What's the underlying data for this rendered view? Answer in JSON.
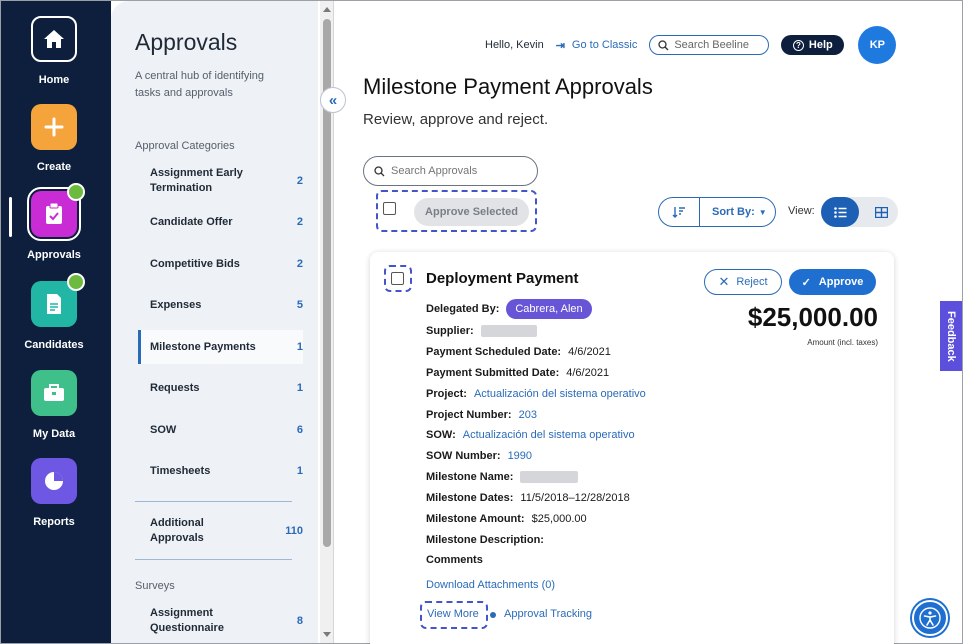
{
  "nav": {
    "items": [
      {
        "label": "Home",
        "icon": "home-icon"
      },
      {
        "label": "Create",
        "icon": "plus-icon"
      },
      {
        "label": "Approvals",
        "icon": "clipboard-check-icon"
      },
      {
        "label": "Candidates",
        "icon": "document-icon"
      },
      {
        "label": "My Data",
        "icon": "briefcase-icon"
      },
      {
        "label": "Reports",
        "icon": "pie-chart-icon"
      }
    ]
  },
  "panel": {
    "title": "Approvals",
    "subtitle": "A central hub of identifying tasks and approvals",
    "categories_header": "Approval Categories",
    "categories": [
      {
        "label": "Assignment Early Termination",
        "count": "2"
      },
      {
        "label": "Candidate Offer",
        "count": "2"
      },
      {
        "label": "Competitive Bids",
        "count": "2"
      },
      {
        "label": "Expenses",
        "count": "5"
      },
      {
        "label": "Milestone Payments",
        "count": "1"
      },
      {
        "label": "Requests",
        "count": "1"
      },
      {
        "label": "SOW",
        "count": "6"
      },
      {
        "label": "Timesheets",
        "count": "1"
      }
    ],
    "additional": {
      "label": "Additional Approvals",
      "count": "110"
    },
    "surveys_header": "Surveys",
    "surveys": [
      {
        "label": "Assignment Questionnaire",
        "count": "8"
      }
    ]
  },
  "topbar": {
    "greeting": "Hello, Kevin",
    "classic_link": "Go to Classic",
    "search_placeholder": "Search Beeline",
    "help_label": "Help",
    "avatar_initials": "KP"
  },
  "main": {
    "title": "Milestone Payment Approvals",
    "subtitle": "Review, approve and reject.",
    "search_placeholder": "Search Approvals",
    "approve_selected_label": "Approve Selected",
    "sort_label": "Sort By:",
    "view_label": "View:"
  },
  "card": {
    "title": "Deployment Payment",
    "reject_label": "Reject",
    "approve_label": "Approve",
    "amount": "$25,000.00",
    "amount_note": "Amount (incl. taxes)",
    "delegated_label": "Delegated By:",
    "delegated_value": "Cabrera, Alen",
    "supplier_label": "Supplier:",
    "scheduled_label": "Payment Scheduled Date:",
    "scheduled_value": "4/6/2021",
    "submitted_label": "Payment Submitted Date:",
    "submitted_value": "4/6/2021",
    "project_label": "Project:",
    "project_value": "Actualización del sistema operativo",
    "project_number_label": "Project Number:",
    "project_number_value": "203",
    "sow_label": "SOW:",
    "sow_value": "Actualización del sistema operativo",
    "sow_number_label": "SOW Number:",
    "sow_number_value": "1990",
    "milestone_name_label": "Milestone Name:",
    "milestone_dates_label": "Milestone Dates:",
    "milestone_dates_value": "11/5/2018–12/28/2018",
    "milestone_amount_label": "Milestone Amount:",
    "milestone_amount_value": "$25,000.00",
    "milestone_description_label": "Milestone Description:",
    "comments_label": "Comments",
    "download_link": "Download Attachments (0)",
    "view_more_link": "View More",
    "tracking_link": "Approval Tracking"
  },
  "feedback_label": "Feedback",
  "colors": {
    "rail": "#0d1f3c",
    "accent": "#2a6bb8",
    "approve": "#1f6fd0",
    "pill": "#6655d6"
  }
}
